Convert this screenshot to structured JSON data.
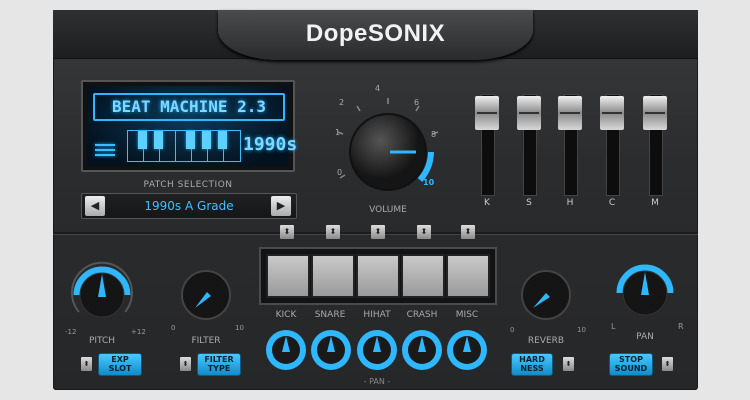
{
  "app": {
    "title": "DopeSONIX"
  },
  "lcd": {
    "title": "BEAT MACHINE 2.3",
    "era": "1990s"
  },
  "patch": {
    "label": "PATCH SELECTION",
    "name": "1990s A Grade",
    "prev": "◀",
    "next": "▶"
  },
  "volume": {
    "label": "VOLUME",
    "ticks": [
      "0",
      "2",
      "4",
      "6",
      "8",
      "10"
    ],
    "extra_tick": "1",
    "value": 9
  },
  "faders": [
    {
      "label": "K"
    },
    {
      "label": "S"
    },
    {
      "label": "H"
    },
    {
      "label": "C"
    },
    {
      "label": "M"
    }
  ],
  "pads": [
    {
      "label": "KICK"
    },
    {
      "label": "SNARE"
    },
    {
      "label": "HIHAT"
    },
    {
      "label": "CRASH"
    },
    {
      "label": "MISC"
    }
  ],
  "pan_group_label": "- PAN -",
  "knobs": {
    "pitch": {
      "label": "PITCH",
      "min": "-12",
      "max": "+12"
    },
    "filter": {
      "label": "FILTER",
      "min": "0",
      "max": "10"
    },
    "reverb": {
      "label": "REVERB",
      "min": "0",
      "max": "10"
    },
    "pan": {
      "label": "PAN",
      "min": "L",
      "max": "R"
    }
  },
  "buttons": {
    "exp_slot": "EXP SLOT",
    "filter_type": "FILTER TYPE",
    "hardness": "HARD NESS",
    "stop_sound": "STOP SOUND"
  },
  "stepper_glyph": "⬍",
  "colors": {
    "accent": "#2fb8ff",
    "panel": "#2b2c2e"
  }
}
